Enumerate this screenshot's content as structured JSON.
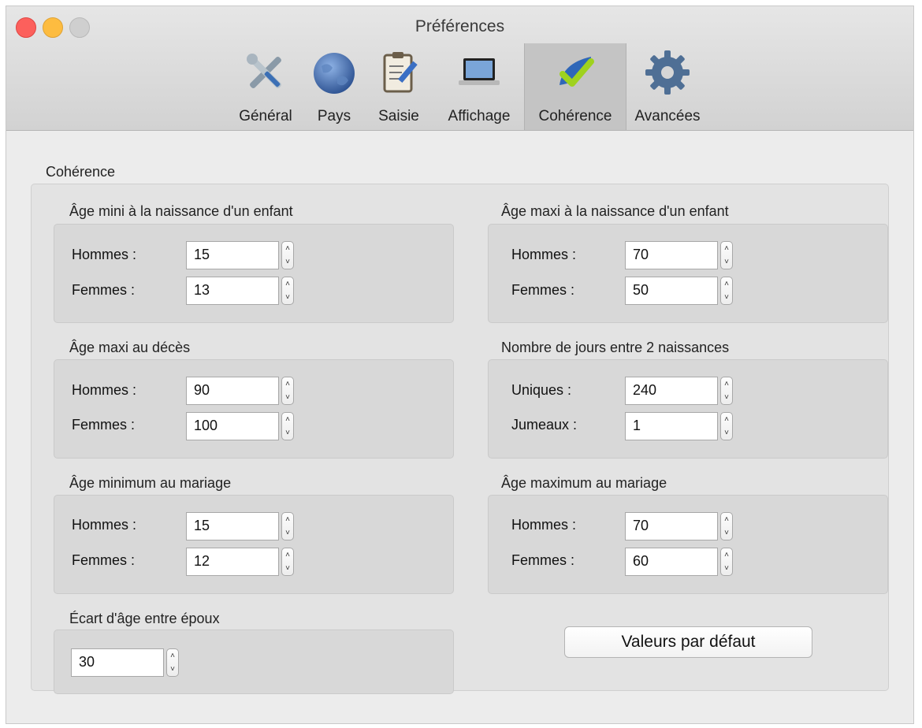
{
  "window": {
    "title": "Préférences"
  },
  "toolbar": {
    "tabs": [
      {
        "label": "Général",
        "icon": "wrench-screwdriver-icon"
      },
      {
        "label": "Pays",
        "icon": "globe-icon"
      },
      {
        "label": "Saisie",
        "icon": "notepad-pencil-icon"
      },
      {
        "label": "Affichage",
        "icon": "laptop-icon"
      },
      {
        "label": "Cohérence",
        "icon": "checkmark-icon",
        "active": true
      },
      {
        "label": "Avancées",
        "icon": "gear-icon"
      }
    ]
  },
  "coherence": {
    "section_label": "Cohérence",
    "groups": {
      "age_mini_enfant": {
        "title": "Âge mini à la naissance d'un enfant",
        "rows": [
          {
            "label": "Hommes :",
            "value": "15"
          },
          {
            "label": "Femmes :",
            "value": "13"
          }
        ]
      },
      "age_maxi_enfant": {
        "title": "Âge maxi à la naissance d'un enfant",
        "rows": [
          {
            "label": "Hommes :",
            "value": "70"
          },
          {
            "label": "Femmes :",
            "value": "50"
          }
        ]
      },
      "age_maxi_deces": {
        "title": "Âge maxi au décès",
        "rows": [
          {
            "label": "Hommes :",
            "value": "90"
          },
          {
            "label": "Femmes :",
            "value": "100"
          }
        ]
      },
      "jours_naissances": {
        "title": "Nombre de jours entre 2 naissances",
        "rows": [
          {
            "label": "Uniques :",
            "value": "240"
          },
          {
            "label": "Jumeaux :",
            "value": "1"
          }
        ]
      },
      "age_min_mariage": {
        "title": "Âge minimum au mariage",
        "rows": [
          {
            "label": "Hommes :",
            "value": "15"
          },
          {
            "label": "Femmes :",
            "value": "12"
          }
        ]
      },
      "age_max_mariage": {
        "title": "Âge maximum au mariage",
        "rows": [
          {
            "label": "Hommes :",
            "value": "70"
          },
          {
            "label": "Femmes :",
            "value": "60"
          }
        ]
      },
      "ecart_epoux": {
        "title": "Écart d'âge entre époux",
        "value": "30"
      }
    },
    "default_button": "Valeurs par défaut"
  },
  "colors": {
    "close": "#fc605c",
    "minimize": "#fdbc40",
    "zoom": "#cfcfcf",
    "active_tab": "#c4c4c4"
  }
}
